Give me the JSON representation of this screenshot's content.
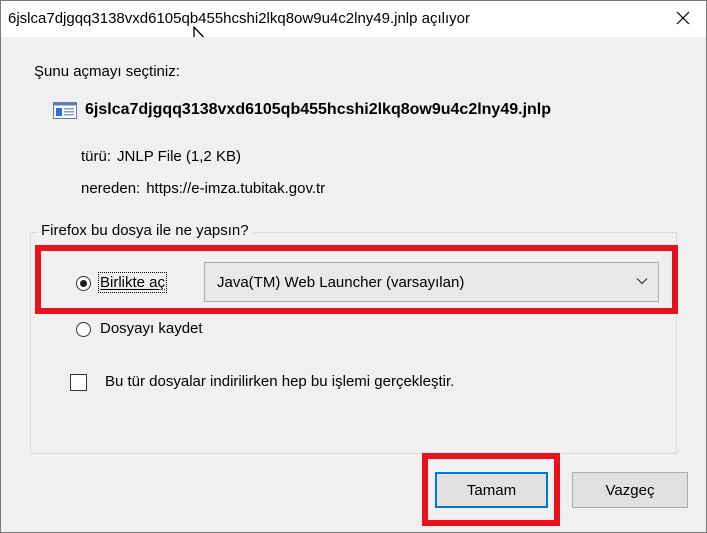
{
  "window": {
    "title": "6jslca7djgqq3138vxd6105qb455hcshi2lkq8ow9u4c2lny49.jnlp açılıyor",
    "close_icon": "close-icon"
  },
  "dialog": {
    "intro": "Şunu açmayı seçtiniz:",
    "file_icon": "file-icon",
    "filename": "6jslca7djgqq3138vxd6105qb455hcshi2lkq8ow9u4c2lny49.jnlp",
    "type_label": "türü:",
    "type_value": "JNLP File (1,2 KB)",
    "from_label": "nereden:",
    "from_value": "https://e-imza.tubitak.gov.tr"
  },
  "action_group": {
    "legend": "Firefox bu dosya ile ne yapsın?",
    "open_with": {
      "label": "Birlikte aç",
      "checked": true,
      "dropdown_value": "Java(TM) Web Launcher (varsayılan)"
    },
    "save_file": {
      "label": "Dosyayı kaydet",
      "checked": false
    },
    "remember": {
      "label": "Bu tür dosyalar indirilirken hep bu işlemi gerçekleştir.",
      "checked": false
    }
  },
  "buttons": {
    "ok": "Tamam",
    "cancel": "Vazgeç"
  },
  "colors": {
    "highlight": "#e8121c",
    "default_button_border": "#0078d7",
    "dialog_background": "#f0f0f0"
  }
}
